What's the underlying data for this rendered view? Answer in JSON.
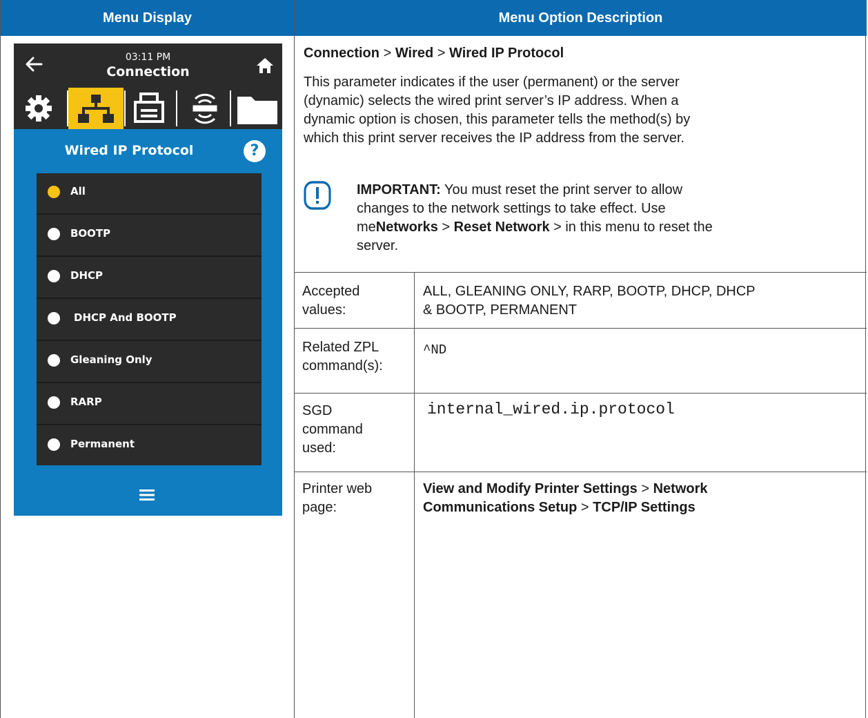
{
  "table": {
    "header_left": "Menu Display",
    "header_right": "Menu Option Description"
  },
  "device": {
    "time": "03:11 PM",
    "title": "Connection",
    "section_title": "Wired IP Protocol",
    "help": "?",
    "accent_color": "#f6c214",
    "selected_tab": "network-icon",
    "options": [
      "All",
      "BOOTP",
      "DHCP",
      "DHCP And BOOTP",
      "Gleaning Only",
      "RARP",
      "Permanent"
    ],
    "selected_option": "All"
  },
  "description": {
    "crumb_1": "Connection",
    "crumb_2": "Wired",
    "crumb_3": "Wired IP Protocol",
    "sep": ">",
    "body_1": "This parameter indicates if the user (permanent) or the server",
    "body_2": "(dynamic) selects the wired print server’s IP address. When a",
    "body_3": "dynamic option is chosen, this parameter tells the method(s) by",
    "body_4": "which this print server receives the IP address from the server.",
    "important_label": "IMPORTANT:",
    "important_1": " You must reset the print server to allow",
    "important_2": "changes to the network settings to take effect. Use",
    "important_3a": "me",
    "important_3b": "Networks",
    "important_3c": " > ",
    "important_3d": "Reset Network",
    "important_3e": " > in this menu to reset the",
    "important_4": "server."
  },
  "rows": {
    "accepted_label_1": "Accepted",
    "accepted_label_2": "values:",
    "accepted_value_1": "ALL, GLEANING ONLY, RARP, BOOTP, DHCP, DHCP",
    "accepted_value_2": "& BOOTP, PERMANENT",
    "zpl_label_1": "Related ZPL",
    "zpl_label_2": "command(s):",
    "zpl_value": "^ND",
    "sgd_label_1": "SGD",
    "sgd_label_2": "command",
    "sgd_label_3": "used:",
    "sgd_value": "internal_wired.ip.protocol",
    "web_label_1": "Printer web",
    "web_label_2": "page:",
    "web_value_1a": "View and Modify Printer Settings",
    "web_value_1b": " > ",
    "web_value_1c": "Network",
    "web_value_2a": "Communications Setup",
    "web_value_2b": " > ",
    "web_value_2c": "TCP/IP Settings"
  }
}
